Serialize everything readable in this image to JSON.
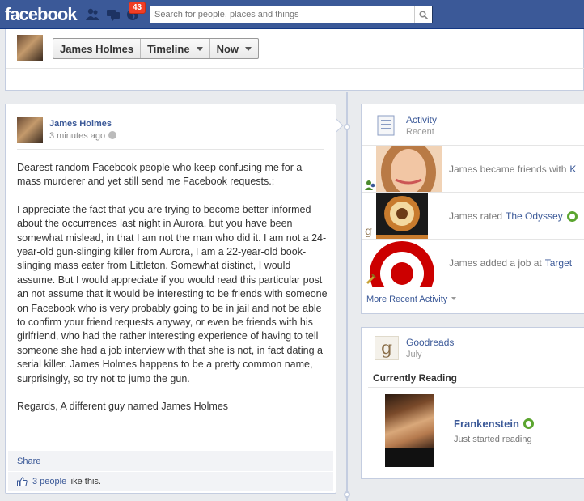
{
  "topbar": {
    "logo": "facebook",
    "notifications_count": "43",
    "search_placeholder": "Search for people, places and things"
  },
  "header": {
    "breadcrumbs": [
      "James Holmes",
      "Timeline",
      "Now"
    ]
  },
  "post": {
    "author": "James Holmes",
    "time": "3 minutes ago",
    "paragraphs": [
      "Dearest random Facebook people who keep confusing me for a mass murderer and yet still send me Facebook requests.;",
      "I appreciate the fact that you are trying to become better-informed about the occurrences last night in Aurora, but you have been somewhat mislead, in that I am not the man who did it. I am not a 24-year-old gun-slinging killer from Aurora, I am a 22-year-old book-slinging mass eater from Littleton. Somewhat distinct, I would assume. But I would appreciate if you would read this particular post an not assume that it would be interesting to be friends with someone on Facebook who is very probably going to be in jail and not be able to confirm your friend requests anyway, or even be friends with his girlfriend, who had the rather interesting experience of having to tell someone she had a job interview with that she is not, in fact dating a serial killer. James Holmes happens to be a pretty common name, surprisingly, so try not to jump the gun.",
      "Regards, A different guy named James Holmes"
    ],
    "share_label": "Share",
    "likes_people": "3 people",
    "likes_tail": "like this."
  },
  "activity": {
    "title": "Activity",
    "subtitle": "Recent",
    "items": [
      {
        "text": "James became friends with",
        "link": "K"
      },
      {
        "text": "James rated",
        "link": "The Odyssey"
      },
      {
        "text": "James added a job at",
        "link": "Target"
      }
    ],
    "more_label": "More Recent Activity"
  },
  "goodreads": {
    "title": "Goodreads",
    "subtitle": "July",
    "section": "Currently Reading",
    "book_title": "Frankenstein",
    "book_status": "Just started reading"
  },
  "colors": {
    "brand_blue": "#3b5998",
    "badge_red": "#f03d25",
    "goodreads_green": "#5ba52f"
  }
}
